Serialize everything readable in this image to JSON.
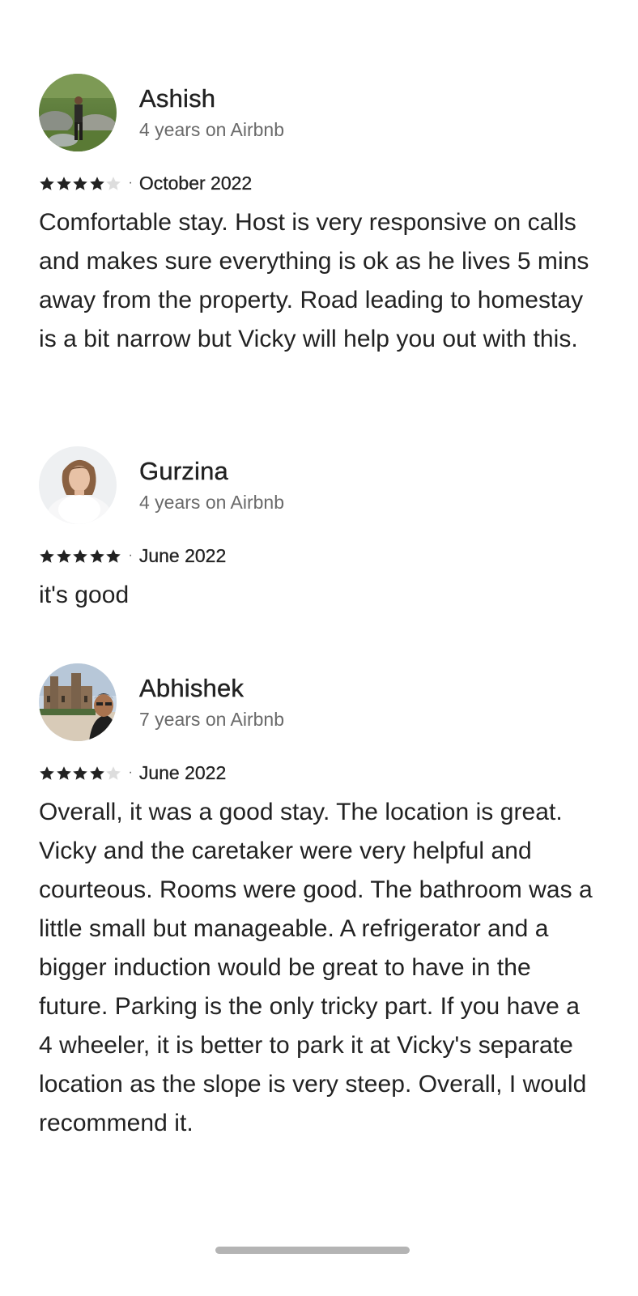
{
  "reviews": [
    {
      "name": "Ashish",
      "tenure": "4 years on Airbnb",
      "rating": 4,
      "separator": "·",
      "date": "October 2022",
      "text": "Comfortable stay. Host is very responsive on calls and makes sure everything is ok as he lives 5 mins away from the property. Road leading to homestay is a bit narrow but Vicky will help you out with this."
    },
    {
      "name": "Gurzina",
      "tenure": "4 years on Airbnb",
      "rating": 5,
      "separator": "·",
      "date": "June 2022",
      "text": "it's good"
    },
    {
      "name": "Abhishek",
      "tenure": "7 years on Airbnb",
      "rating": 4,
      "separator": "·",
      "date": "June 2022",
      "text": "Overall, it was a good stay. The location is great. Vicky and the caretaker were very helpful and courteous. Rooms were good. The bathroom was a little small but manageable. A refrigerator and a bigger induction would be great to have in the future. Parking is the only tricky part. If you have a 4 wheeler, it is better to park it at Vicky's separate location as the slope is very steep. Overall, I would recommend it."
    }
  ],
  "colors": {
    "text": "#222222",
    "secondary_text": "#6a6a6a",
    "star_filled": "#222222",
    "star_empty": "#dddddd",
    "home_indicator": "#b4b4b4"
  },
  "icons": {
    "star": "star-icon"
  }
}
